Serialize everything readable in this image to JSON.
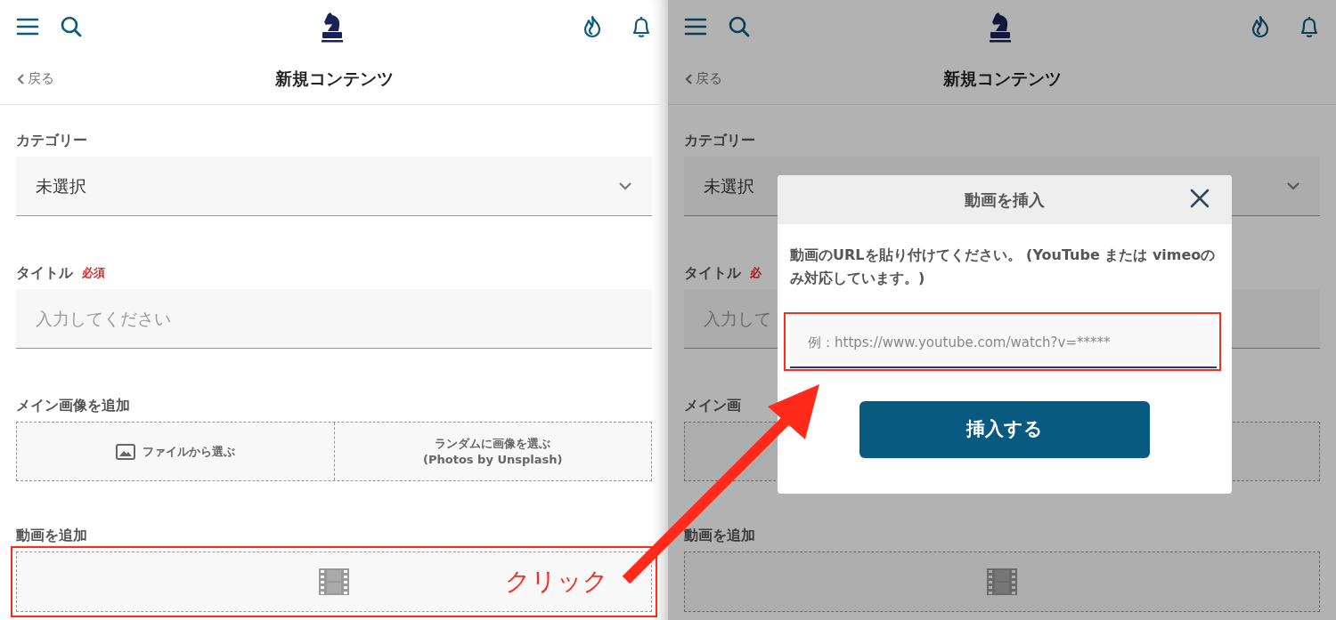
{
  "screens": [
    {
      "back_link": "戻る",
      "page_title": "新規コンテンツ",
      "category": {
        "label": "カテゴリー",
        "value": "未選択"
      },
      "title_field": {
        "label": "タイトル",
        "required": "必須",
        "placeholder": "入力してください"
      },
      "main_image": {
        "label": "メイン画像を追加",
        "buttons": [
          {
            "kind": "file",
            "lines": [
              "ファイルから選ぶ"
            ]
          },
          {
            "kind": "random",
            "lines": [
              "ランダムに画像を選ぶ",
              "(Photos by Unsplash)"
            ]
          }
        ]
      },
      "video": {
        "label": "動画を追加",
        "highlighted": true
      }
    },
    {
      "back_link": "戻る",
      "page_title": "新規コンテンツ",
      "category": {
        "label": "カテゴリー",
        "value": "未選択"
      },
      "title_field": {
        "label": "タイトル",
        "required": "必",
        "placeholder": "入力して"
      },
      "main_image": {
        "label": "メイン画"
      },
      "video": {
        "label": "動画を追加",
        "highlighted": false
      },
      "dialog": {
        "title": "動画を挿入",
        "message": "動画のURLを貼り付けてください。 (YouTube または vimeoのみ対応しています。)",
        "placeholder": "例：https://www.youtube.com/watch?v=*****",
        "submit": "挿入する"
      }
    }
  ],
  "annotation": {
    "click_label": "クリック"
  }
}
